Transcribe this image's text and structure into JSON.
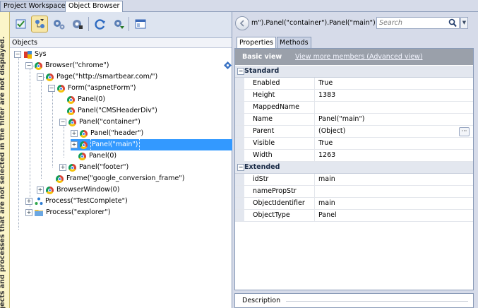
{
  "tabs": {
    "project_workspace": "Project Workspace",
    "object_browser": "Object Browser"
  },
  "side_strip": {
    "text": "Objects and processes that are not selected in the filter are not displayed."
  },
  "left": {
    "objects_header": "Objects"
  },
  "tree": [
    {
      "label": "Sys"
    },
    {
      "label": "Browser(\"chrome\")"
    },
    {
      "label": "Page(\"http://smartbear.com/\")"
    },
    {
      "label": "Form(\"aspnetForm\")"
    },
    {
      "label": "Panel(0)"
    },
    {
      "label": "Panel(\"CMSHeaderDiv\")"
    },
    {
      "label": "Panel(\"container\")"
    },
    {
      "label": "Panel(\"header\")"
    },
    {
      "label": "Panel(\"main\")"
    },
    {
      "label": "Panel(0)"
    },
    {
      "label": "Panel(\"footer\")"
    },
    {
      "label": "Frame(\"google_conversion_frame\")"
    },
    {
      "label": "BrowserWindow(0)"
    },
    {
      "label": "Process(\"TestComplete\")"
    },
    {
      "label": "Process(\"explorer\")"
    }
  ],
  "right": {
    "address": "m\").Panel(\"container\").Panel(\"main\")",
    "search_placeholder": "Search",
    "tab_properties": "Properties",
    "tab_methods": "Methods",
    "basic_view": "Basic view",
    "view_more": "View more members (Advanced view)",
    "description": "Description"
  },
  "properties": {
    "standard": {
      "label": "Standard",
      "rows": [
        {
          "name": "Enabled",
          "value": "True"
        },
        {
          "name": "Height",
          "value": "1383"
        },
        {
          "name": "MappedName",
          "value": ""
        },
        {
          "name": "Name",
          "value": "Panel(\"main\")"
        },
        {
          "name": "Parent",
          "value": "(Object)"
        },
        {
          "name": "Visible",
          "value": "True"
        },
        {
          "name": "Width",
          "value": "1263"
        }
      ]
    },
    "extended": {
      "label": "Extended",
      "rows": [
        {
          "name": "idStr",
          "value": "main"
        },
        {
          "name": "namePropStr",
          "value": ""
        },
        {
          "name": "ObjectIdentifier",
          "value": "main"
        },
        {
          "name": "ObjectType",
          "value": "Panel"
        }
      ]
    }
  }
}
